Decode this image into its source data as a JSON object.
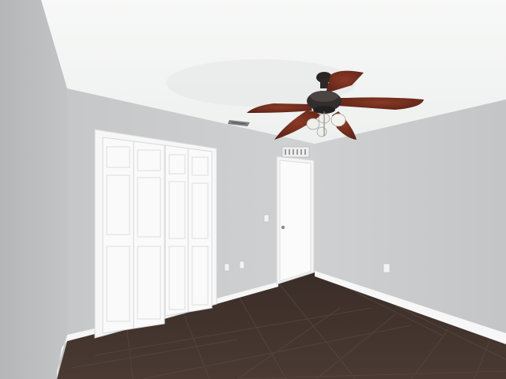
{
  "scene": {
    "description_tags": [
      "empty-bedroom",
      "ceiling-fan",
      "bifold-closet",
      "interior-door",
      "tile-floor"
    ]
  },
  "watermark": {
    "text": ""
  },
  "colors": {
    "ceiling": "#f4f5f4",
    "wall_left": "#b9bbbc",
    "wall_back": "#cbcccd",
    "wall_right": "#c9cacb",
    "floor": "#3d302a",
    "trim": "#f7f7f7",
    "fan_blade": "#6a2a1c",
    "fan_motor": "#2f2b2a"
  }
}
